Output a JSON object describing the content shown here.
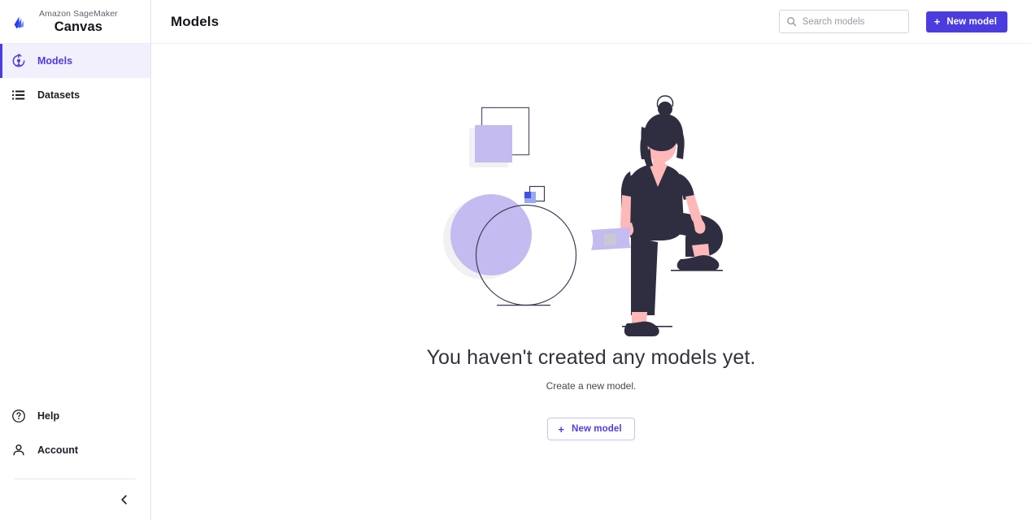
{
  "brand": {
    "subtitle": "Amazon SageMaker",
    "title": "Canvas",
    "logo_icon": "sagemaker-logo-icon"
  },
  "sidebar": {
    "items": [
      {
        "label": "Models",
        "icon": "model-target-icon",
        "active": true
      },
      {
        "label": "Datasets",
        "icon": "list-icon",
        "active": false
      }
    ],
    "bottom_items": [
      {
        "label": "Help",
        "icon": "question-circle-icon"
      },
      {
        "label": "Account",
        "icon": "person-icon"
      }
    ],
    "collapse_icon": "chevron-left-icon"
  },
  "header": {
    "title": "Models",
    "search": {
      "placeholder": "Search models",
      "value": "",
      "icon": "search-icon"
    },
    "new_model_button": {
      "label": "New model",
      "icon": "plus-icon"
    }
  },
  "empty_state": {
    "illustration": "person-with-abstract-shapes-illustration",
    "title": "You haven't created any models yet.",
    "subtitle": "Create a new model.",
    "button": {
      "label": "New model",
      "icon": "plus-icon"
    }
  },
  "colors": {
    "accent_purple": "#4b3ce0",
    "active_nav_bg": "#f2f0fd",
    "illustration_purple": "#c4bbf0",
    "illustration_dark": "#2f2e41",
    "illustration_skin": "#ffb8b8",
    "illustration_blue": "#4b6ef5",
    "text_primary": "#16161d",
    "border": "#e4e4e7"
  }
}
